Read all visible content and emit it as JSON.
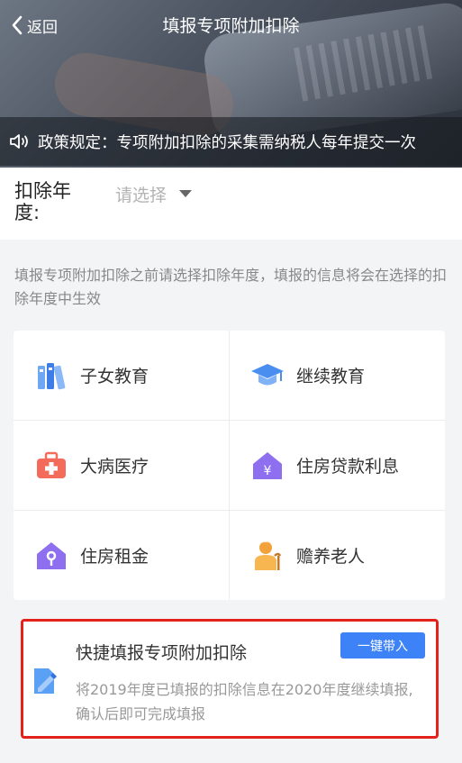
{
  "header": {
    "back_label": "返回",
    "title": "填报专项附加扣除"
  },
  "notice": {
    "text": "政策规定：专项附加扣除的采集需纳税人每年提交一次"
  },
  "year_selector": {
    "label": "扣除年度:",
    "placeholder": "请选择"
  },
  "hint": "填报专项附加扣除之前请选择扣除年度，填报的信息将会在选择的扣除年度中生效",
  "categories": [
    {
      "label": "子女教育",
      "icon": "books-icon"
    },
    {
      "label": "继续教育",
      "icon": "graduation-cap-icon"
    },
    {
      "label": "大病医疗",
      "icon": "medical-kit-icon"
    },
    {
      "label": "住房贷款利息",
      "icon": "house-yuan-icon"
    },
    {
      "label": "住房租金",
      "icon": "house-key-icon"
    },
    {
      "label": "赡养老人",
      "icon": "elderly-person-icon"
    }
  ],
  "quick_fill": {
    "title": "快捷填报专项附加扣除",
    "button_label": "一键带入",
    "description": "将2019年度已填报的扣除信息在2020年度继续填报,确认后即可完成填报"
  },
  "colors": {
    "accent_blue": "#3d82f6",
    "highlight_red": "#e3221c"
  }
}
